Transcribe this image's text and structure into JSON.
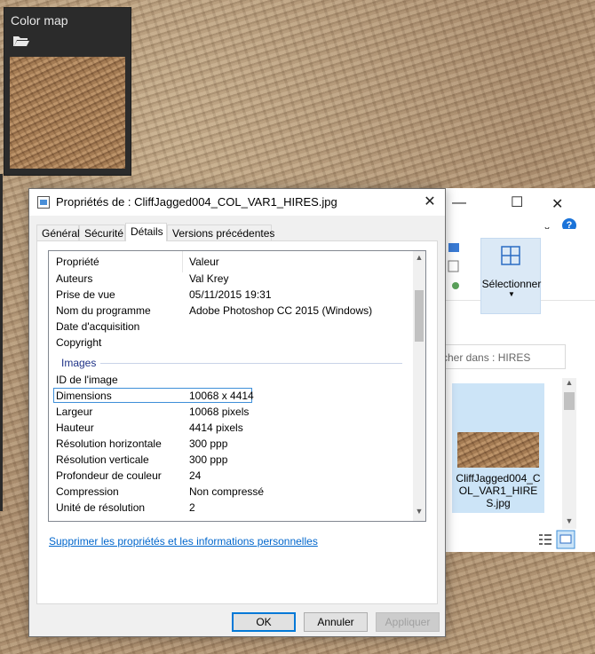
{
  "color_map_panel": {
    "title": "Color map",
    "icons": [
      "folder-open-icon"
    ]
  },
  "explorer": {
    "controls": [
      "minimize-icon",
      "maximize-icon",
      "close-icon"
    ],
    "ribbon_select_label": "Sélectionner",
    "search_text": "cher dans : HIRES",
    "file_name": "CliffJagged004_COL_VAR1_HIRES.jpg"
  },
  "dialog": {
    "title": "Propriétés de : CliffJagged004_COL_VAR1_HIRES.jpg",
    "close": "✕",
    "tabs": [
      {
        "label": "Général"
      },
      {
        "label": "Sécurité"
      },
      {
        "label": "Détails"
      },
      {
        "label": "Versions précédentes"
      }
    ],
    "columns": {
      "property": "Propriété",
      "value": "Valeur"
    },
    "rows_top": [
      {
        "k": "Auteurs",
        "v": "Val Krey"
      },
      {
        "k": "Prise de vue",
        "v": "05/11/2015 19:31"
      },
      {
        "k": "Nom du programme",
        "v": "Adobe Photoshop CC 2015 (Windows)"
      },
      {
        "k": "Date d'acquisition",
        "v": ""
      },
      {
        "k": "Copyright",
        "v": ""
      }
    ],
    "group_images": "Images",
    "rows_images": [
      {
        "k": "ID de l'image",
        "v": ""
      },
      {
        "k": "Dimensions",
        "v": "10068 x 4414"
      },
      {
        "k": "Largeur",
        "v": "10068 pixels"
      },
      {
        "k": "Hauteur",
        "v": "4414 pixels"
      },
      {
        "k": "Résolution horizontale",
        "v": "300 ppp"
      },
      {
        "k": "Résolution verticale",
        "v": "300 ppp"
      },
      {
        "k": "Profondeur de couleur",
        "v": "24"
      },
      {
        "k": "Compression",
        "v": "Non compressé"
      },
      {
        "k": "Unité de résolution",
        "v": "2"
      }
    ],
    "remove_link": "Supprimer les propriétés et les informations personnelles",
    "buttons": {
      "ok": "OK",
      "cancel": "Annuler",
      "apply": "Appliquer"
    }
  }
}
